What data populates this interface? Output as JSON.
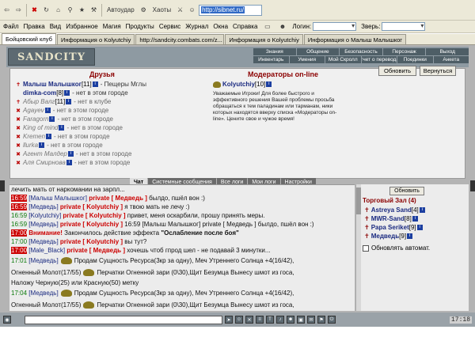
{
  "browser": {
    "nav_items": [
      {
        "icon": "back-arrow-icon",
        "glyph": "⇦"
      },
      {
        "icon": "forward-arrow-icon",
        "glyph": "⇨"
      },
      {
        "icon": "stop-icon",
        "glyph": "✖"
      },
      {
        "icon": "refresh-icon",
        "glyph": "↻"
      },
      {
        "icon": "home-icon",
        "glyph": "⌂"
      }
    ],
    "toolbar_label_1": "Автоудар",
    "toolbar_label_2": "Хаоты",
    "address": "http://sibnet.ru/",
    "menu": [
      "Файл",
      "Правка",
      "Вид",
      "Избранное",
      "Магия",
      "Продукты",
      "Сервис",
      "Журнал",
      "Окна",
      "Справка"
    ],
    "login_label": "Логин:",
    "beast_label": "Зверь:",
    "tabs": [
      {
        "label": "Бойцовский клуб",
        "active": true
      },
      {
        "label": "Информация о Kolyutchiy",
        "active": false
      },
      {
        "label": "http://sandcity.combats.com/z...",
        "active": false
      },
      {
        "label": "Информация о Kolyutchiy",
        "active": false
      },
      {
        "label": "Информация о Малыш Малышког",
        "active": false
      }
    ]
  },
  "game": {
    "logo": "SANDCITY",
    "nav_row1": [
      "Знания",
      "Общение",
      "Безопасность",
      "Персонаж",
      "Выход"
    ],
    "nav_row2": [
      "Инвентарь",
      "Умения",
      "Мой Скролл",
      "Отчет о переводах",
      "Поединки",
      "Анкета"
    ],
    "refresh": "Обновить",
    "back": "Вернуться",
    "friends_title": "Друзья",
    "moderators_title": "Модераторы on-line",
    "friends": [
      {
        "name": "Малыш Малышког",
        "level": "[11]",
        "status": "- Пещеры Мглы",
        "online": true,
        "cross": true
      },
      {
        "name": "dimka-com",
        "level": "[8]",
        "status": "- нет в этом городе",
        "online": true,
        "cross": false
      },
      {
        "name": "Абыр Валг",
        "level": "[11]",
        "status": "- нет в клубе",
        "online": false,
        "cross": true
      },
      {
        "name": "Agayev",
        "level": "",
        "status": "- нет в этом городе",
        "online": false,
        "cross": false
      },
      {
        "name": "Faragorn",
        "level": "",
        "status": "- нет в этом городе",
        "online": false,
        "cross": false
      },
      {
        "name": "King of mind",
        "level": "",
        "status": "- нет в этом городе",
        "online": false,
        "cross": false
      },
      {
        "name": "Kremen",
        "level": "",
        "status": "- нет в этом городе",
        "online": false,
        "cross": false
      },
      {
        "name": "llurka",
        "level": "",
        "status": "- нет в этом городе",
        "online": false,
        "cross": false
      },
      {
        "name": "Агент Малдер",
        "level": "",
        "status": "- нет в этом городе",
        "online": false,
        "cross": false
      },
      {
        "name": "Аля Смирнова",
        "level": "",
        "status": "- нет в этом городе",
        "online": false,
        "cross": false
      }
    ],
    "moderator": {
      "name": "Kolyutchiy",
      "level": "[10]"
    },
    "moderator_notice": "Уважаемые Игроки! Для более быстрого и эффективного решения Вашей проблемы просьба обращаться к тем паладинам или тарманам, ники которых находятся вверху списка «Модераторы on-line». Цените свое и чужое время!",
    "chat_tabs": [
      "Чат",
      "Системные сообщения",
      "Все логи",
      "Мои логи",
      "Настройки"
    ],
    "chat_lines": [
      {
        "type": "plain",
        "text": "лечить мать от наркомании на зарпл..."
      },
      {
        "type": "msg",
        "time": "16:59",
        "time_red": true,
        "user": "[Малыш Малышког]",
        "priv": "private [ Медведь ]",
        "text": "былдо, пшёл вон :)"
      },
      {
        "type": "msg",
        "time": "16:59",
        "time_red": true,
        "user": "[Медведь]",
        "priv": "private [ Kolyutchiy ]",
        "text": "я твою мать не лечу :)"
      },
      {
        "type": "msg",
        "time": "16:59",
        "time_red": false,
        "user": "[Kolyutchiy]",
        "priv": "private [ Kolyutchiy ]",
        "text": "привет, меня оскарбили, прошу принять меры."
      },
      {
        "type": "msg",
        "time": "16:59",
        "time_red": false,
        "user": "[Медведь]",
        "priv": "private [ Kolyutchiy ]",
        "text": "16:59 [Малыш Малышког] private [ Медведь ] былдо, пшёл вон :)"
      },
      {
        "type": "warn",
        "time": "17:00",
        "bold": "Внимание!",
        "text": "Закончилось действие эффекта",
        "effect": "\"Ослабление после боя\""
      },
      {
        "type": "msg",
        "time": "17:00",
        "time_red": false,
        "user": "[Медведь]",
        "priv": "private [ Kolyutchiy ]",
        "text": "вы тут?"
      },
      {
        "type": "msg",
        "time": "17:00",
        "time_red": true,
        "user": "[Male_Black]",
        "priv": "private [ Медведь ]",
        "text": "хочешь чтоб гпрод шел - не подавай 3 минутки..."
      },
      {
        "type": "trade",
        "time": "17:01",
        "user": "[Медведь]",
        "text": "Продам Сущность Ресурса(3кр за одну), Меч Утреннего Солнца +4(16/42),"
      },
      {
        "type": "trade2",
        "text": "Огненный Молот(17/55)",
        "text2": "Перчатки Огненной зари (0\\30),Щит Безумца Вынесу шмот из госа,"
      },
      {
        "type": "plain",
        "text": "Наложу Черную(25) или Красную(50) метку"
      },
      {
        "type": "trade",
        "time": "17:04",
        "user": "[Медведь]",
        "text": "Продам Сущность Ресурса(3кр за одну), Меч Утреннего Солнца +4(16/42),"
      },
      {
        "type": "trade2",
        "text": "Огненный Молот(17/55)",
        "text2": "Перчатки Огненной зари (0\\30),Щит Безумца Вынесу шмот из госа,"
      }
    ],
    "room_refresh": "Обновить",
    "room_title": "Торговый Зал (4)",
    "room_users": [
      {
        "name": "Astreya Sand",
        "level": "[4]"
      },
      {
        "name": "MWR-Sand",
        "level": "[8]"
      },
      {
        "name": "Papa Seriket",
        "level": "[9]"
      },
      {
        "name": "Медведь",
        "level": "[9]"
      }
    ],
    "auto_refresh": "Обновлять автомат.",
    "clock": "17:18"
  }
}
